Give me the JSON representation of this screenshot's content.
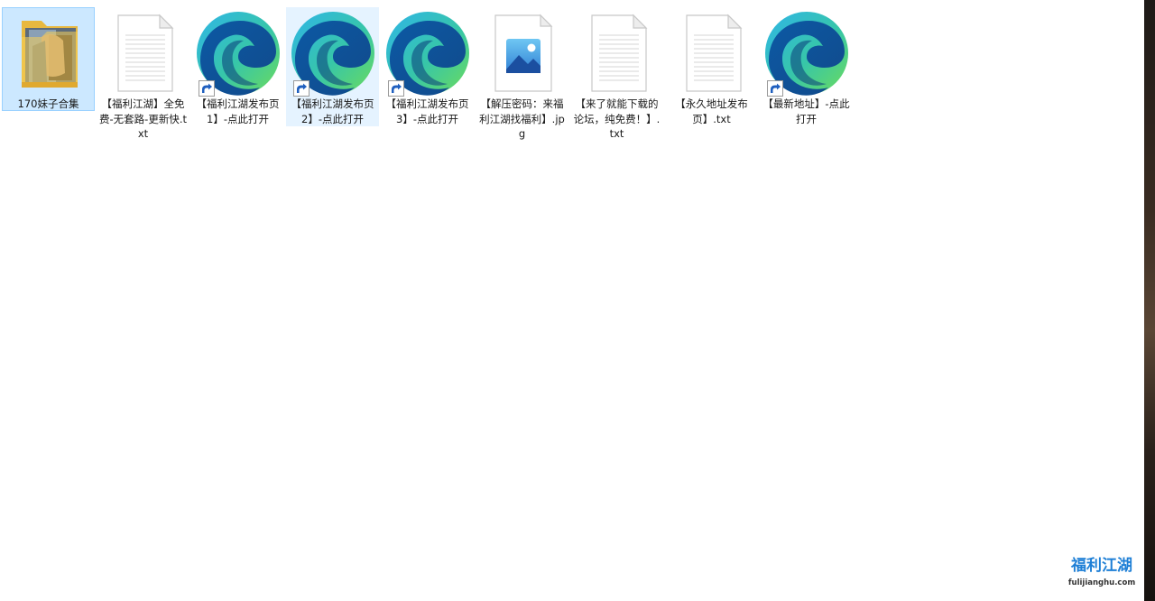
{
  "files": [
    {
      "name": "170妹子合集",
      "type": "folder",
      "icon": "folder-icon",
      "state": "selected"
    },
    {
      "name": "【福利江湖】全免费-无套路-更新快.txt",
      "type": "text",
      "icon": "text-file-icon",
      "state": ""
    },
    {
      "name": "【福利江湖发布页1】-点此打开",
      "type": "shortcut",
      "icon": "edge-shortcut-icon",
      "state": ""
    },
    {
      "name": "【福利江湖发布页2】-点此打开",
      "type": "shortcut",
      "icon": "edge-shortcut-icon",
      "state": "hover"
    },
    {
      "name": "【福利江湖发布页3】-点此打开",
      "type": "shortcut",
      "icon": "edge-shortcut-icon",
      "state": ""
    },
    {
      "name": "【解压密码：来福利江湖找福利】.jpg",
      "type": "image",
      "icon": "image-file-icon",
      "state": ""
    },
    {
      "name": "【来了就能下载的论坛，纯免费！】.txt",
      "type": "text",
      "icon": "text-file-icon",
      "state": ""
    },
    {
      "name": "【永久地址发布页】.txt",
      "type": "text",
      "icon": "text-file-icon",
      "state": ""
    },
    {
      "name": "【最新地址】-点此打开",
      "type": "shortcut",
      "icon": "edge-shortcut-icon",
      "state": ""
    }
  ],
  "watermark": {
    "title": "福利江湖",
    "url": "fulijianghu.com"
  },
  "colors": {
    "selection_bg": "#cce8ff",
    "selection_border": "#99d1ff",
    "hover_bg": "#e5f3ff",
    "watermark_blue": "#1e7fd6"
  }
}
